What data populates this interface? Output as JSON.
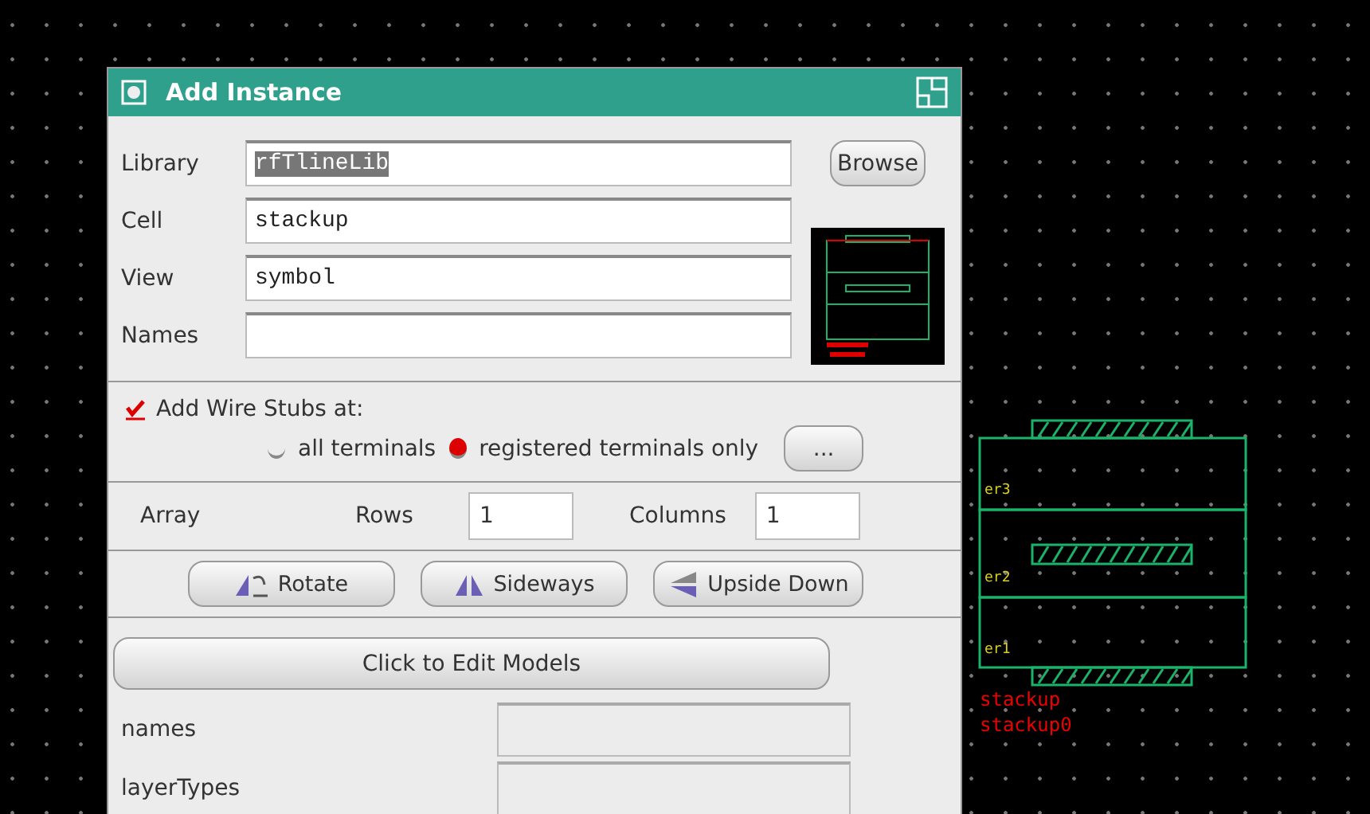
{
  "window": {
    "title": "Add Instance"
  },
  "fields": [
    {
      "label": "Library",
      "value": "rfTlineLib",
      "highlighted": true
    },
    {
      "label": "Cell",
      "value": "stackup",
      "highlighted": false
    },
    {
      "label": "View",
      "value": "symbol",
      "highlighted": false
    },
    {
      "label": "Names"
    }
  ],
  "browse_button": "Browse",
  "wire_stubs": {
    "label": "Add Wire Stubs at:",
    "checked": true,
    "options": [
      {
        "label": "all terminals",
        "selected": false
      },
      {
        "label": "registered terminals only",
        "selected": true
      }
    ],
    "more_button": "..."
  },
  "array": {
    "label": "Array",
    "rows_label": "Rows",
    "rows": "1",
    "columns_label": "Columns",
    "columns": "1"
  },
  "transform_buttons": [
    {
      "label": "Rotate",
      "kind": "rotate"
    },
    {
      "label": "Sideways",
      "kind": "sideways"
    },
    {
      "label": "Upside Down",
      "kind": "upsidedown"
    }
  ],
  "models_button": "Click to Edit Models",
  "model_fields": [
    {
      "label": "names"
    },
    {
      "label": "layerTypes"
    }
  ],
  "schematic": {
    "layer_labels": [
      "er3",
      "er2",
      "er1"
    ],
    "cell_name": "stackup",
    "instance_name": "stackup0"
  }
}
